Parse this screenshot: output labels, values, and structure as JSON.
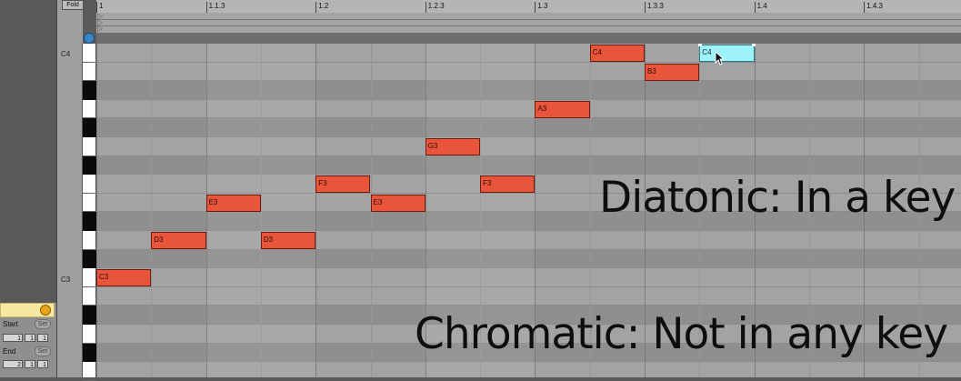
{
  "header": {
    "fold_label": "Fold"
  },
  "ruler": {
    "labels": [
      "1",
      "1.1.3",
      "1.2",
      "1.2.3",
      "1.3",
      "1.3.3",
      "1.4",
      "1.4.3"
    ]
  },
  "keyboard": {
    "pitch_labels": {
      "c4": "C4",
      "c3": "C3"
    }
  },
  "notes": [
    {
      "label": "C3",
      "pitch": "C3",
      "start_beat": 0.0,
      "length_beats": 0.5
    },
    {
      "label": "D3",
      "pitch": "D3",
      "start_beat": 0.5,
      "length_beats": 0.5
    },
    {
      "label": "E3",
      "pitch": "E3",
      "start_beat": 1.0,
      "length_beats": 0.5
    },
    {
      "label": "D3",
      "pitch": "D3",
      "start_beat": 1.5,
      "length_beats": 0.5
    },
    {
      "label": "F3",
      "pitch": "F3",
      "start_beat": 2.0,
      "length_beats": 0.5
    },
    {
      "label": "E3",
      "pitch": "E3",
      "start_beat": 2.5,
      "length_beats": 0.5
    },
    {
      "label": "G3",
      "pitch": "G3",
      "start_beat": 3.0,
      "length_beats": 0.5
    },
    {
      "label": "F3",
      "pitch": "F3",
      "start_beat": 3.5,
      "length_beats": 0.5
    },
    {
      "label": "A3",
      "pitch": "A3",
      "start_beat": 4.0,
      "length_beats": 0.5
    },
    {
      "label": "C4",
      "pitch": "C4",
      "start_beat": 4.5,
      "length_beats": 0.5
    },
    {
      "label": "B3",
      "pitch": "B3",
      "start_beat": 5.0,
      "length_beats": 0.5
    },
    {
      "label": "C4",
      "pitch": "C4",
      "start_beat": 5.5,
      "length_beats": 0.5,
      "selected": true
    }
  ],
  "overlay": {
    "diatonic": "Diatonic: In a key",
    "chromatic": "Chromatic: Not in any key"
  },
  "clip_panel": {
    "start_label": "Start",
    "end_label": "End",
    "set_label": "Set",
    "start_values": [
      "1",
      "1",
      "1"
    ],
    "end_values": [
      "2",
      "1",
      "1"
    ]
  },
  "colors": {
    "note": "#e8553b",
    "selected_note": "#9ef3fb",
    "clip_header": "#f6e7a1",
    "fold_button_accent": "#3a86c8"
  }
}
